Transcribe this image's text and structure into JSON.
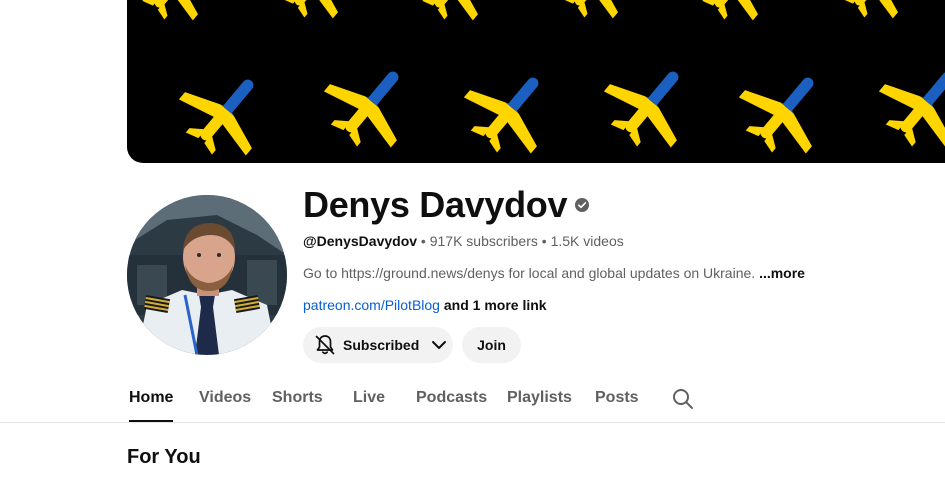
{
  "channel": {
    "name": "Denys Davydov",
    "handle": "@DenysDavydov",
    "subscribers": "917K subscribers",
    "videos": "1.5K videos",
    "separator": "•",
    "description": "Go to https://ground.news/denys for local and global updates on Ukraine.",
    "more_label": "...more",
    "link": "patreon.com/PilotBlog",
    "more_links": "and 1 more link"
  },
  "buttons": {
    "subscribed": "Subscribed",
    "join": "Join"
  },
  "tabs": [
    "Home",
    "Videos",
    "Shorts",
    "Live",
    "Podcasts",
    "Playlists",
    "Posts"
  ],
  "active_tab": "Home",
  "section": {
    "title": "For You"
  },
  "colors": {
    "banner_background": "#000000",
    "plane_blue": "#1b5fc1",
    "plane_yellow": "#ffd500",
    "link": "#065fd4",
    "button_bg": "#f2f2f2"
  },
  "icons": {
    "verified": "check-circle-icon",
    "bell": "bell-icon",
    "dropdown": "chevron-down-icon",
    "search": "search-icon"
  }
}
